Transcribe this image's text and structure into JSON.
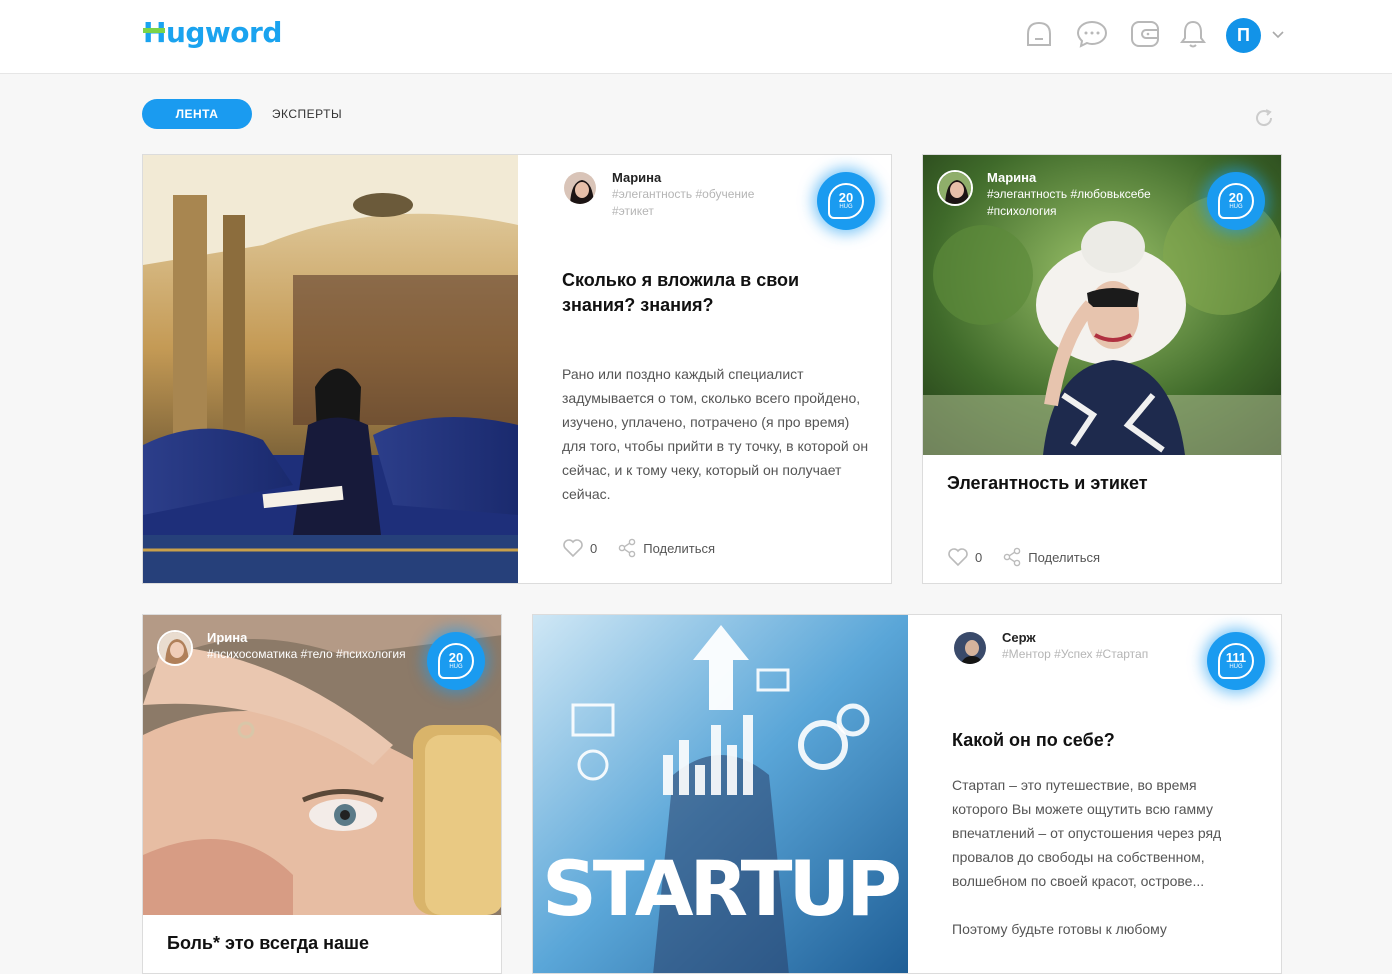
{
  "header": {
    "logo": "Hugword",
    "logo_first_letter": "H",
    "logo_rest": "ugword",
    "avatar_letter": "П",
    "icons": [
      "home-icon",
      "chat-icon",
      "wallet-icon",
      "bell-icon",
      "chevron-down-icon"
    ]
  },
  "tabs": {
    "active": "ЛЕНТА",
    "other": "ЭКСПЕРТЫ"
  },
  "colors": {
    "accent": "#1a9bf0",
    "logo_green": "#7bd447",
    "tag_gray": "#b5b5b5"
  },
  "posts": [
    {
      "author": "Марина",
      "tags": "#элегантность #обучение #этикет",
      "hug_count": "20",
      "hug_label": "HUG",
      "title": "Сколько я вложила в свои знания? знания?",
      "excerpt": "Рано или поздно каждый специалист задумывается о том, сколько всего пройдено, изучено, уплачено, потрачено (я про время) для того, чтобы прийти в ту точку, в которой он сейчас, и к тому чеку, который он получает сейчас.",
      "likes": "0",
      "share_label": "Поделиться"
    },
    {
      "author": "Марина",
      "tags": "#элегантность #любовьксебе #психология",
      "hug_count": "20",
      "hug_label": "HUG",
      "title": "Элегантность и этикет",
      "likes": "0",
      "share_label": "Поделиться"
    },
    {
      "author": "Ирина",
      "tags": "#психосоматика #тело #психология",
      "hug_count": "20",
      "hug_label": "HUG",
      "title": "Боль* это всегда наше"
    },
    {
      "author": "Серж",
      "tags": "#Ментор #Успех #Стартап",
      "hug_count": "111",
      "hug_label": "HUG",
      "title": "Какой он по себе?",
      "excerpt": "Стартап – это путешествие, во время которого Вы можете ощутить всю гамму впечатлений – от опустошения через ряд провалов до свободы на собственном, волшебном по своей красот, острове...",
      "excerpt2": "Поэтому будьте готовы к любому",
      "image_text": "STARTUP"
    }
  ]
}
